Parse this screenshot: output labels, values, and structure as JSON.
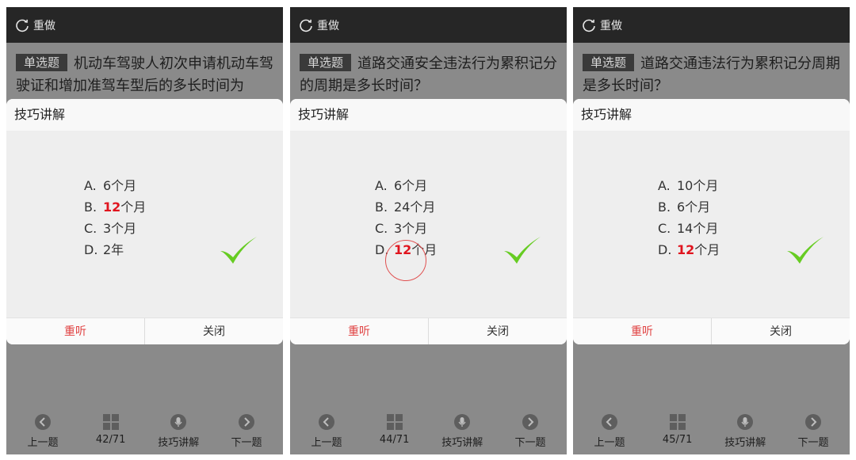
{
  "panels": [
    {
      "topbar": {
        "redo_label": "重做"
      },
      "question": {
        "type": "单选题",
        "text": "机动车驾驶人初次申请机动车驾驶证和增加准驾车型后的多长时间为"
      },
      "popup": {
        "title": "技巧讲解",
        "options": [
          {
            "letter": "A.",
            "pre": "6个月",
            "hl": "",
            "post": ""
          },
          {
            "letter": "B.",
            "pre": "",
            "hl": "12",
            "post": "个月"
          },
          {
            "letter": "C.",
            "pre": "3个月",
            "hl": "",
            "post": ""
          },
          {
            "letter": "D.",
            "pre": "2年",
            "hl": "",
            "post": ""
          }
        ],
        "replay_label": "重听",
        "close_label": "关闭"
      },
      "nav": {
        "prev": "上一题",
        "progress": "42/71",
        "tips": "技巧讲解",
        "next": "下一题"
      }
    },
    {
      "topbar": {
        "redo_label": "重做"
      },
      "question": {
        "type": "单选题",
        "text": "道路交通安全违法行为累积记分的周期是多长时间？"
      },
      "popup": {
        "title": "技巧讲解",
        "options": [
          {
            "letter": "A.",
            "pre": "6个月",
            "hl": "",
            "post": ""
          },
          {
            "letter": "B.",
            "pre": "24个月",
            "hl": "",
            "post": ""
          },
          {
            "letter": "C.",
            "pre": "3个月",
            "hl": "",
            "post": ""
          },
          {
            "letter": "D.",
            "pre": "",
            "hl": "12",
            "post": "个月"
          }
        ],
        "replay_label": "重听",
        "close_label": "关闭"
      },
      "nav": {
        "prev": "上一题",
        "progress": "44/71",
        "tips": "技巧讲解",
        "next": "下一题"
      }
    },
    {
      "topbar": {
        "redo_label": "重做"
      },
      "question": {
        "type": "单选题",
        "text": "道路交通违法行为累积记分周期是多长时间？"
      },
      "popup": {
        "title": "技巧讲解",
        "options": [
          {
            "letter": "A.",
            "pre": "10个月",
            "hl": "",
            "post": ""
          },
          {
            "letter": "B.",
            "pre": "6个月",
            "hl": "",
            "post": ""
          },
          {
            "letter": "C.",
            "pre": "14个月",
            "hl": "",
            "post": ""
          },
          {
            "letter": "D.",
            "pre": "",
            "hl": "12",
            "post": "个月"
          }
        ],
        "replay_label": "重听",
        "close_label": "关闭"
      },
      "nav": {
        "prev": "上一题",
        "progress": "45/71",
        "tips": "技巧讲解",
        "next": "下一题"
      }
    }
  ],
  "colors": {
    "highlight": "#e0141e",
    "check": "#66cc22",
    "topbar": "#262626",
    "backdrop": "#8a8a8a"
  }
}
